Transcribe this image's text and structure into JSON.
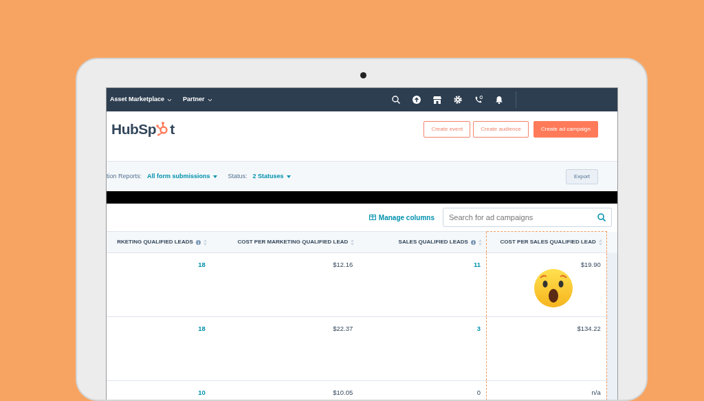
{
  "topnav": {
    "items": [
      {
        "label": "Asset Marketplace"
      },
      {
        "label": "Partner"
      }
    ]
  },
  "header": {
    "logo": {
      "before": "HubSp",
      "after": "t"
    },
    "buttons": [
      {
        "label": "Create event",
        "kind": "outline"
      },
      {
        "label": "Create audience",
        "kind": "outline"
      },
      {
        "label": "Create ad campaign",
        "kind": "primary"
      }
    ]
  },
  "filters": [
    {
      "label": "tion Reports:",
      "value": "All form submissions"
    },
    {
      "label": "Status:",
      "value": "2 Statuses"
    }
  ],
  "export_button": "Export",
  "toolbar": {
    "manage_columns": "Manage columns",
    "search": {
      "placeholder": "Search for ad campaigns"
    }
  },
  "table": {
    "columns": [
      {
        "label": "RKETING QUALIFIED LEADS",
        "info": true,
        "highlighted": false
      },
      {
        "label": "COST PER MARKETING QUALIFIED LEAD",
        "info": false,
        "highlighted": false
      },
      {
        "label": "SALES QUALIFIED LEADS",
        "info": true,
        "highlighted": false
      },
      {
        "label": "COST PER SALES QUALIFIED LEAD",
        "info": false,
        "highlighted": true
      }
    ],
    "rows": [
      {
        "cells": [
          {
            "text": "18",
            "link": true
          },
          {
            "text": "$12.16",
            "link": false
          },
          {
            "text": "11",
            "link": true
          },
          {
            "text": "$19.90",
            "link": false
          }
        ]
      },
      {
        "cells": [
          {
            "text": "18",
            "link": true
          },
          {
            "text": "$22.37",
            "link": false
          },
          {
            "text": "3",
            "link": true
          },
          {
            "text": "$134.22",
            "link": false
          }
        ]
      },
      {
        "cells": [
          {
            "text": "10",
            "link": true
          },
          {
            "text": "$10.05",
            "link": false
          },
          {
            "text": "0",
            "link": false
          },
          {
            "text": "n/a",
            "link": false
          }
        ]
      }
    ]
  }
}
